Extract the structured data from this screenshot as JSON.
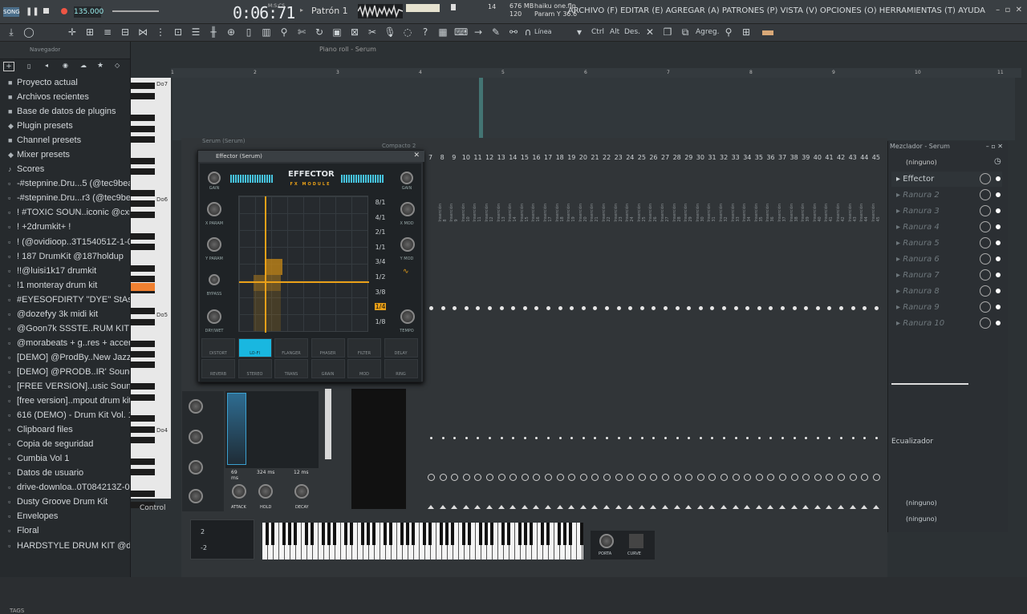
{
  "app": {
    "song_label": "SONG",
    "tempo": "135.000",
    "time": "0:06:71",
    "time_sub": "M:S:CS",
    "pattern": "Patrón 1",
    "bars": "14",
    "memory": [
      "676 MB",
      "120"
    ],
    "project_file": "haiku one.flp",
    "param_hint": "Param Y 36.6"
  },
  "menu": "ARCHIVO (F) EDITAR (E) AGREGAR (A) PATRONES (P) VISTA (V) OPCIONES (O) HERRAMIENTAS (T) AYUDA",
  "toolbar2": {
    "linea": "Línea",
    "ctrl": "Ctrl",
    "alt": "Alt",
    "des": "Des.",
    "agreg": "Agreg."
  },
  "browser": {
    "title": "Navegador",
    "tags": "TAGS",
    "items": [
      "Proyecto actual",
      "Archivos recientes",
      "Base de datos de plugins",
      "Plugin presets",
      "Channel presets",
      "Mixer presets",
      "Scores",
      "-#stepnine.Dru...5 (@tec9beat)",
      "-#stepnine.Dru...r3 (@tec9beat)",
      "!  #TOXIC SOUN..iconic @cxsket",
      "!  +2drumkit+ !",
      "! (@ovidioop..3T154051Z-1-001",
      "! 187 DrumKit @187holdup",
      "!!@luisi1k17 drumkit",
      "!1 monteray drum kit",
      "#EYESOFDIRTY ''DYE'' StAshKit",
      "@dozefyy 3k midi kit",
      "@Goon7k SSSTE..RUM KIT 2k26",
      "@morabeats + g..res + accents)",
      "[DEMO] @ProdBy..New Jazz Kit",
      "[DEMO] @PRODB..IR' Sound Kit",
      "[FREE VERSION]..usic Sound Kit",
      "[free version]..mpout drum kit",
      "616 (DEMO) -  Drum Kit Vol. 1",
      "Clipboard files",
      "Copia de seguridad",
      "Cumbia Vol 1",
      "Datos de usuario",
      "drive-downloa..0T084213Z-001",
      "Dusty Groove Drum Kit",
      "Envelopes",
      "Floral",
      "HARDSTYLE DRUM KIT @dopekit"
    ]
  },
  "pianoroll": {
    "title": "Piano roll - Serum",
    "octaves": [
      "Do7",
      "Do6",
      "Do5",
      "Do4"
    ],
    "ruler": [
      "1",
      "2",
      "3",
      "4",
      "5",
      "6",
      "7",
      "8",
      "9",
      "10",
      "11"
    ]
  },
  "channelrack": {
    "title": "Serum (Serum)",
    "compacto": "Compacto 2",
    "control": "Control"
  },
  "effector": {
    "window_title": "Effector (Serum)",
    "logo": "EFFECTOR",
    "logo_sub": "FX MODULE",
    "labels": {
      "gain_l": "GAIN",
      "gain_r": "GAIN",
      "xparam": "X PARAM",
      "yparam": "Y PARAM",
      "bypass": "BYPASS",
      "drywet": "DRY/WET",
      "xmod": "X MOD",
      "ymod": "Y MOD",
      "tempo": "TEMPO"
    },
    "divisions": [
      "8/1",
      "4/1",
      "2/1",
      "1/1",
      "3/4",
      "1/2",
      "3/8",
      "1/4",
      "1/8"
    ],
    "selected_division": "1/4",
    "fx_row1": [
      "DISTORT",
      "LO-FI",
      "FLANGER",
      "PHASER",
      "FILTER",
      "DELAY"
    ],
    "fx_row2": [
      "REVERB",
      "STEREO",
      "TRANS",
      "GRAIN",
      "MOD",
      "RING"
    ],
    "active_fx": "LO-FI"
  },
  "envelope": {
    "attack_val": "69 ms",
    "hold_val": "324 ms",
    "decay_val": "12 ms",
    "attack": "ATTACK",
    "hold": "HOLD",
    "decay": "DECAY",
    "porta": "PORTA",
    "curve": "CURVE"
  },
  "mixer": {
    "title": "Mezclador - Serum",
    "preset": "(ninguno)",
    "slots": [
      "Effector",
      "Ranura 2",
      "Ranura 3",
      "Ranura 4",
      "Ranura 5",
      "Ranura 6",
      "Ranura 7",
      "Ranura 8",
      "Ranura 9",
      "Ranura 10"
    ],
    "eq": "Ecualizador",
    "out1": "(ninguno)",
    "out2": "(ninguno)"
  },
  "inserts": {
    "numbers": [
      "7",
      "8",
      "9",
      "10",
      "11",
      "12",
      "13",
      "14",
      "15",
      "16",
      "17",
      "18",
      "19",
      "20",
      "21",
      "22",
      "23",
      "24",
      "25",
      "26",
      "27",
      "28",
      "29",
      "30",
      "31",
      "32",
      "33",
      "34",
      "35",
      "36",
      "37",
      "38",
      "39",
      "40",
      "41",
      "42",
      "43",
      "44",
      "45"
    ],
    "labels": [
      "Inserción 8",
      "Inserción 9",
      "Inserción 10",
      "Inserción 11",
      "Inserción 12",
      "Inserción 13",
      "Inserción 14",
      "Inserción 15",
      "Inserción 16",
      "Inserción 17",
      "Inserción 18",
      "Inserción 19",
      "Inserción 20",
      "Inserción 21",
      "Inserción 22",
      "Inserción 23",
      "Inserción 24",
      "Inserción 25",
      "Inserción 26",
      "Inserción 27",
      "Inserción 28",
      "Inserción 29",
      "Inserción 30",
      "Inserción 31",
      "Inserción 32",
      "Inserción 33",
      "Inserción 34",
      "Inserción 35",
      "Inserción 36",
      "Inserción 37",
      "Inserción 38",
      "Inserción 39",
      "Inserción 40",
      "Inserción 41",
      "Inserción 42",
      "Inserción 43",
      "Inserción 44",
      "Inserción 45"
    ]
  },
  "colors": {
    "accent": "#e9a018",
    "cyan": "#19b7e0"
  }
}
